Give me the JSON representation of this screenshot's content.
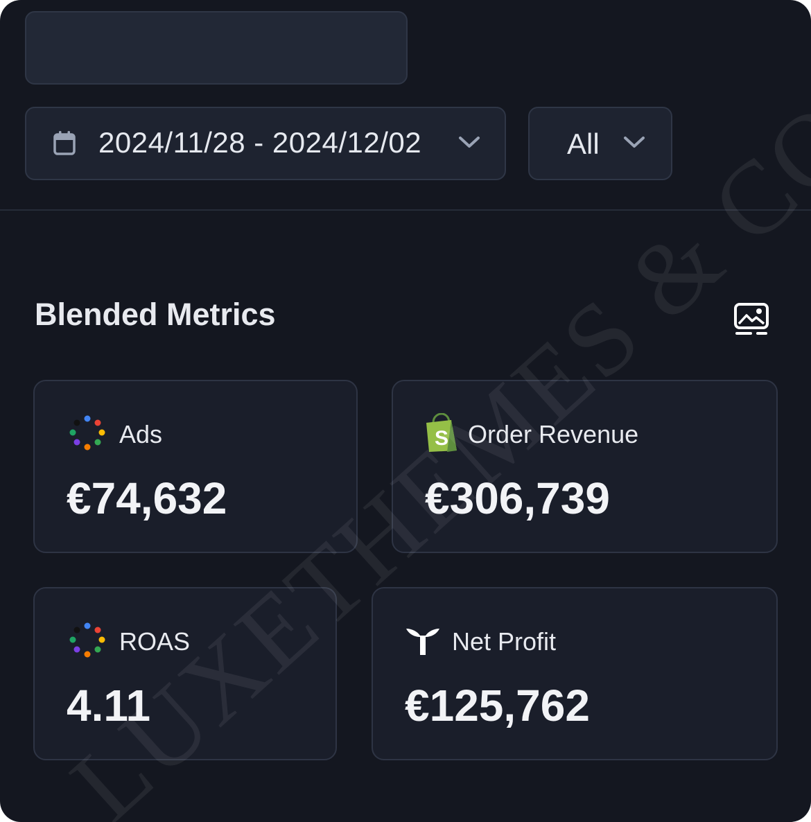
{
  "filters": {
    "date_range": "2024/11/28 - 2024/12/02",
    "channel": "All"
  },
  "section": {
    "title": "Blended Metrics"
  },
  "cards": [
    {
      "label": "Ads",
      "value": "€74,632",
      "icon": "multicolor-dots-icon"
    },
    {
      "label": "Order Revenue",
      "value": "€306,739",
      "icon": "shopify-bag-icon"
    },
    {
      "label": "ROAS",
      "value": "4.11",
      "icon": "multicolor-dots-icon"
    },
    {
      "label": "Net Profit",
      "value": "€125,762",
      "icon": "triple-whale-logo-icon"
    }
  ],
  "watermark": "LUXETHEMES & CO.",
  "colors": {
    "background": "#141720",
    "card": "#1a1e2a",
    "shopify_green": "#95bf47"
  }
}
